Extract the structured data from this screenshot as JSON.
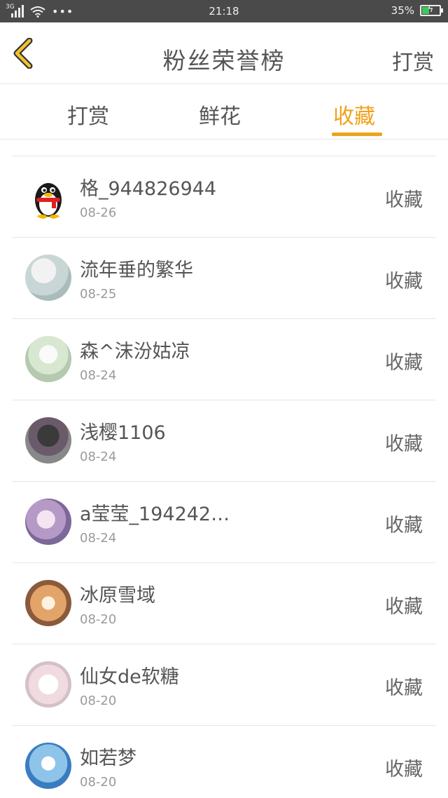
{
  "status_bar": {
    "network": "3G",
    "time": "21:18",
    "battery": "35%",
    "battery_level": 0.35
  },
  "header": {
    "title": "粉丝荣誉榜",
    "action_label": "打赏"
  },
  "tabs": [
    {
      "label": "打赏",
      "active": false
    },
    {
      "label": "鲜花",
      "active": false
    },
    {
      "label": "收藏",
      "active": true
    }
  ],
  "colors": {
    "accent": "#f0a21a",
    "text": "#555555",
    "muted": "#9a9a9a",
    "divider": "#e6e6e6"
  },
  "fans": [
    {
      "name": "格_944826944",
      "date": "08-26",
      "action": "收藏",
      "avatar": "qq-penguin"
    },
    {
      "name": "流年垂的繁华",
      "date": "08-25",
      "action": "收藏",
      "avatar": "photo"
    },
    {
      "name": "森^沫汾姑凉",
      "date": "08-24",
      "action": "收藏",
      "avatar": "anime"
    },
    {
      "name": "浅樱1106",
      "date": "08-24",
      "action": "收藏",
      "avatar": "photo"
    },
    {
      "name": "a莹莹_194242…",
      "date": "08-24",
      "action": "收藏",
      "avatar": "anime"
    },
    {
      "name": "冰原雪域",
      "date": "08-20",
      "action": "收藏",
      "avatar": "illustration"
    },
    {
      "name": "仙女de软糖",
      "date": "08-20",
      "action": "收藏",
      "avatar": "illustration"
    },
    {
      "name": "如若梦",
      "date": "08-20",
      "action": "收藏",
      "avatar": "anime"
    }
  ]
}
